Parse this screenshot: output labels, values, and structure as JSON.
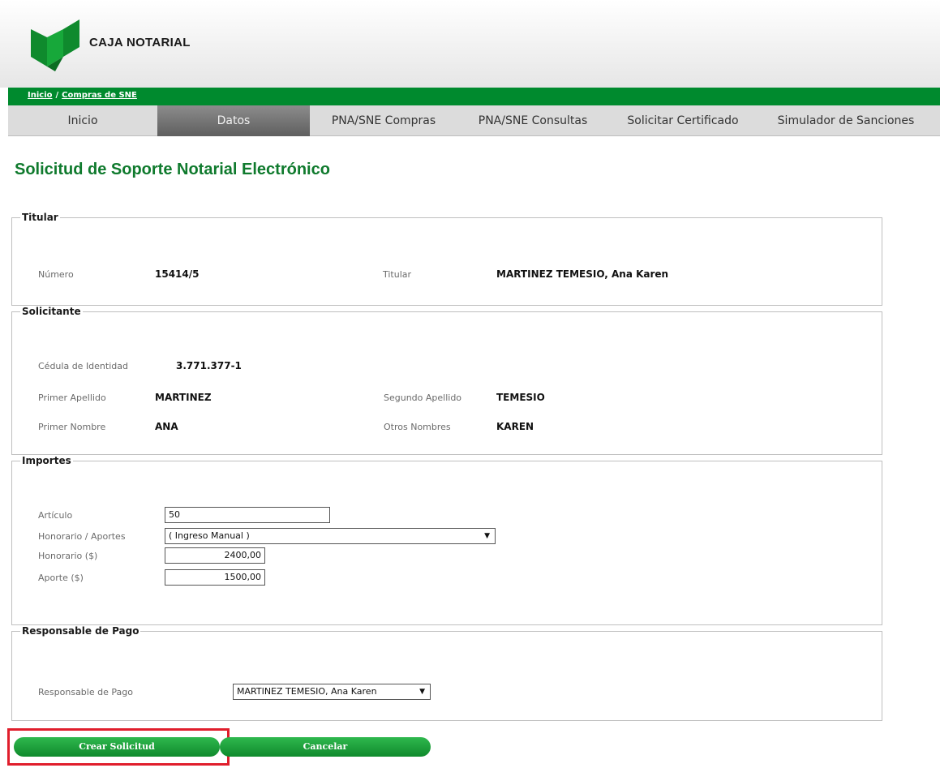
{
  "brand": {
    "name": "CAJA NOTARIAL",
    "color": "#008a2e"
  },
  "breadcrumb": {
    "home": "Inicio",
    "separator": "/",
    "current": "Compras de SNE"
  },
  "nav": {
    "items": [
      {
        "label": "Inicio",
        "active": false
      },
      {
        "label": "Datos",
        "active": true
      },
      {
        "label": "PNA/SNE Compras",
        "active": false
      },
      {
        "label": "PNA/SNE Consultas",
        "active": false
      },
      {
        "label": "Solicitar Certificado",
        "active": false
      },
      {
        "label": "Simulador de Sanciones",
        "active": false
      }
    ]
  },
  "page": {
    "title": "Solicitud de Soporte Notarial Electrónico"
  },
  "titular": {
    "legend": "Titular",
    "numero_label": "Número",
    "numero_value": "15414/5",
    "titular_label": "Titular",
    "titular_value": "MARTINEZ TEMESIO, Ana Karen"
  },
  "solicitante": {
    "legend": "Solicitante",
    "cedula_label": "Cédula de Identidad",
    "cedula_value": "3.771.377-1",
    "primer_apellido_label": "Primer Apellido",
    "primer_apellido_value": "MARTINEZ",
    "segundo_apellido_label": "Segundo Apellido",
    "segundo_apellido_value": "TEMESIO",
    "primer_nombre_label": "Primer Nombre",
    "primer_nombre_value": "ANA",
    "otros_nombres_label": "Otros Nombres",
    "otros_nombres_value": "KAREN"
  },
  "importes": {
    "legend": "Importes",
    "articulo_label": "Artículo",
    "articulo_value": "50",
    "honorario_aportes_label": "Honorario / Aportes",
    "honorario_aportes_value": "( Ingreso Manual )",
    "honorario_label": "Honorario ($)",
    "honorario_value": "2400,00",
    "aporte_label": "Aporte ($)",
    "aporte_value": "1500,00"
  },
  "responsable": {
    "legend": "Responsable de Pago",
    "label": "Responsable de Pago",
    "value": "MARTINEZ TEMESIO, Ana Karen"
  },
  "actions": {
    "create_label": "Crear Solicitud",
    "cancel_label": "Cancelar"
  }
}
